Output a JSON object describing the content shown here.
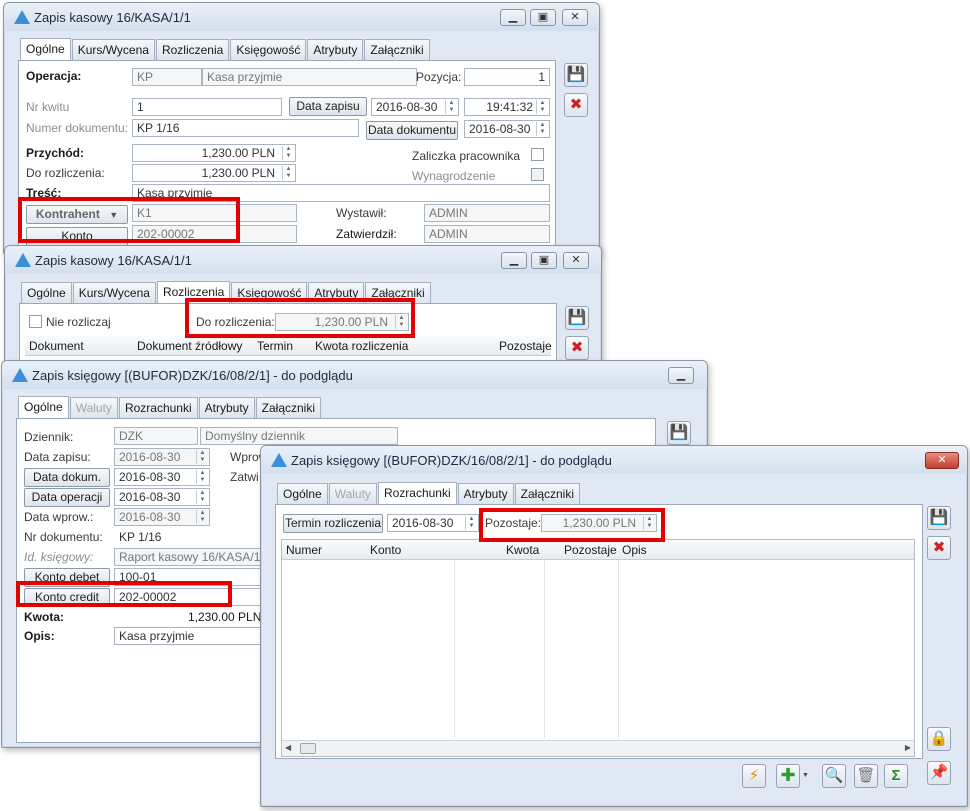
{
  "win1": {
    "title": "Zapis kasowy 16/KASA/1/1",
    "tabs": [
      "Ogólne",
      "Kurs/Wycena",
      "Rozliczenia",
      "Księgowość",
      "Atrybuty",
      "Załączniki"
    ],
    "operacja_label": "Operacja:",
    "operacja_code": "KP",
    "operacja_name": "Kasa przyjmie",
    "pozycja_label": "Pozycja:",
    "pozycja_value": "1",
    "nr_kwitu_label": "Nr kwitu",
    "nr_kwitu_value": "1",
    "data_zapisu_btn": "Data zapisu",
    "data_zapisu_value": "2016-08-30",
    "time_value": "19:41:32",
    "numer_dok_label": "Numer dokumentu:",
    "numer_dok_value": "KP 1/16",
    "data_dok_btn": "Data dokumentu",
    "data_dok_value": "2016-08-30",
    "przychod_label": "Przychód:",
    "przychod_value": "1,230.00 PLN",
    "zaliczka_label": "Zaliczka pracownika",
    "do_rozl_label": "Do rozliczenia:",
    "do_rozl_value": "1,230.00 PLN",
    "wynagrodzenie_label": "Wynagrodzenie",
    "tresc_label": "Treść:",
    "tresc_value": "Kasa przyjmie",
    "kontrahent_btn": "Kontrahent",
    "kontrahent_value": "K1",
    "wystawil_label": "Wystawił:",
    "wystawil_value": "ADMIN",
    "konto_btn": "Konto",
    "konto_value": "202-00002",
    "zatwierdzil_label": "Zatwierdził:",
    "zatwierdzil_value": "ADMIN"
  },
  "win2": {
    "title": "Zapis kasowy 16/KASA/1/1",
    "tabs": [
      "Ogólne",
      "Kurs/Wycena",
      "Rozliczenia",
      "Księgowość",
      "Atrybuty",
      "Załączniki"
    ],
    "nie_rozliczaj_label": "Nie rozliczaj",
    "do_rozl_label": "Do rozliczenia:",
    "do_rozl_value": "1,230.00 PLN",
    "columns": [
      "Dokument",
      "Dokument źródłowy",
      "Termin",
      "Kwota rozliczenia",
      "Pozostaje"
    ]
  },
  "win3": {
    "title": "Zapis księgowy [(BUFOR)DZK/16/08/2/1] - do podglądu",
    "tabs": [
      "Ogólne",
      "Waluty",
      "Rozrachunki",
      "Atrybuty",
      "Załączniki"
    ],
    "dziennik_label": "Dziennik:",
    "dziennik_code": "DZK",
    "dziennik_name": "Domyślny dziennik",
    "data_zapisu_label": "Data zapisu:",
    "data_zapisu_value": "2016-08-30",
    "wprow_label": "Wprow",
    "data_dok_btn": "Data dokum.",
    "data_dok_value": "2016-08-30",
    "zatwi_label": "Zatwi",
    "data_oper_btn": "Data operacji",
    "data_oper_value": "2016-08-30",
    "data_wprow_label": "Data wprow.:",
    "data_wprow_value": "2016-08-30",
    "nr_dok_label": "Nr dokumentu:",
    "nr_dok_value": "KP 1/16",
    "id_ksieg_label": "Id. księgowy:",
    "id_ksieg_value": "Raport kasowy 16/KASA/1",
    "konto_debet_btn": "Konto debet",
    "konto_debet_value": "100-01",
    "konto_credit_btn": "Konto credit",
    "konto_credit_value": "202-00002",
    "kwota_label": "Kwota:",
    "kwota_value": "1,230.00 PLN",
    "opis_label": "Opis:",
    "opis_value": "Kasa przyjmie"
  },
  "win4": {
    "title": "Zapis księgowy [(BUFOR)DZK/16/08/2/1] - do podglądu",
    "tabs": [
      "Ogólne",
      "Waluty",
      "Rozrachunki",
      "Atrybuty",
      "Załączniki"
    ],
    "termin_btn": "Termin rozliczenia",
    "termin_value": "2016-08-30",
    "pozostaje_label": "Pozostaje:",
    "pozostaje_value": "1,230.00 PLN",
    "columns": [
      "Numer",
      "Konto",
      "Kwota",
      "Pozostaje",
      "Opis"
    ]
  },
  "icons": {
    "save": "save-icon",
    "cancel": "cancel-icon",
    "lightning": "lightning-icon",
    "add": "add-icon",
    "search": "search-icon",
    "delete": "trash-icon",
    "sum": "sigma-icon",
    "lock": "lock-icon",
    "pin": "pin-icon"
  },
  "colors": {
    "highlight": "#e30000",
    "accent": "#3a8fd8"
  }
}
